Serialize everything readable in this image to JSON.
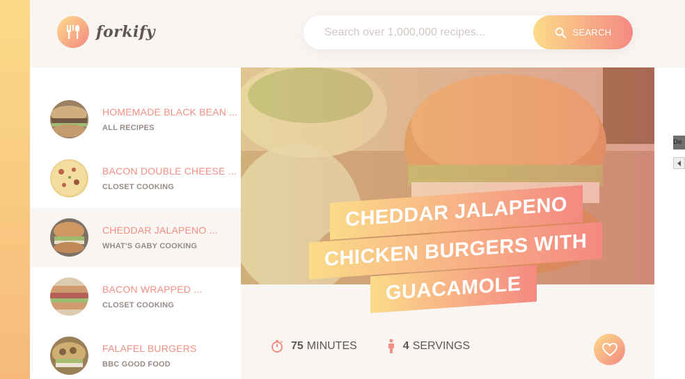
{
  "header": {
    "logo_text": "forkify",
    "search_placeholder": "Search over 1,000,000 recipes...",
    "search_button": "SEARCH"
  },
  "results": [
    {
      "title": "HOMEMADE BLACK BEAN ...",
      "author": "ALL RECIPES",
      "active": false
    },
    {
      "title": "BACON DOUBLE CHEESE ...",
      "author": "CLOSET COOKING",
      "active": false
    },
    {
      "title": "CHEDDAR JALAPENO ...",
      "author": "WHAT'S GABY COOKING",
      "active": true
    },
    {
      "title": "BACON WRAPPED ...",
      "author": "CLOSET COOKING",
      "active": false
    },
    {
      "title": "FALAFEL BURGERS",
      "author": "BBC GOOD FOOD",
      "active": false
    }
  ],
  "recipe": {
    "title_lines": [
      "CHEDDAR JALAPENO",
      "CHICKEN BURGERS WITH",
      "GUACAMOLE"
    ],
    "time_value": "75",
    "time_unit": "MINUTES",
    "servings_value": "4",
    "servings_unit": "SERVINGS"
  },
  "edge": {
    "stub_text": "De"
  },
  "colors": {
    "accent_start": "#fbdb89",
    "accent_end": "#f48982",
    "text_primary": "#615551",
    "text_secondary": "#968b87",
    "panel_bg": "#f9f5f3"
  },
  "icons": {
    "logo": "fork-knife-icon",
    "search": "search-icon",
    "time": "stopwatch-icon",
    "servings": "person-icon",
    "favorite": "heart-icon"
  }
}
